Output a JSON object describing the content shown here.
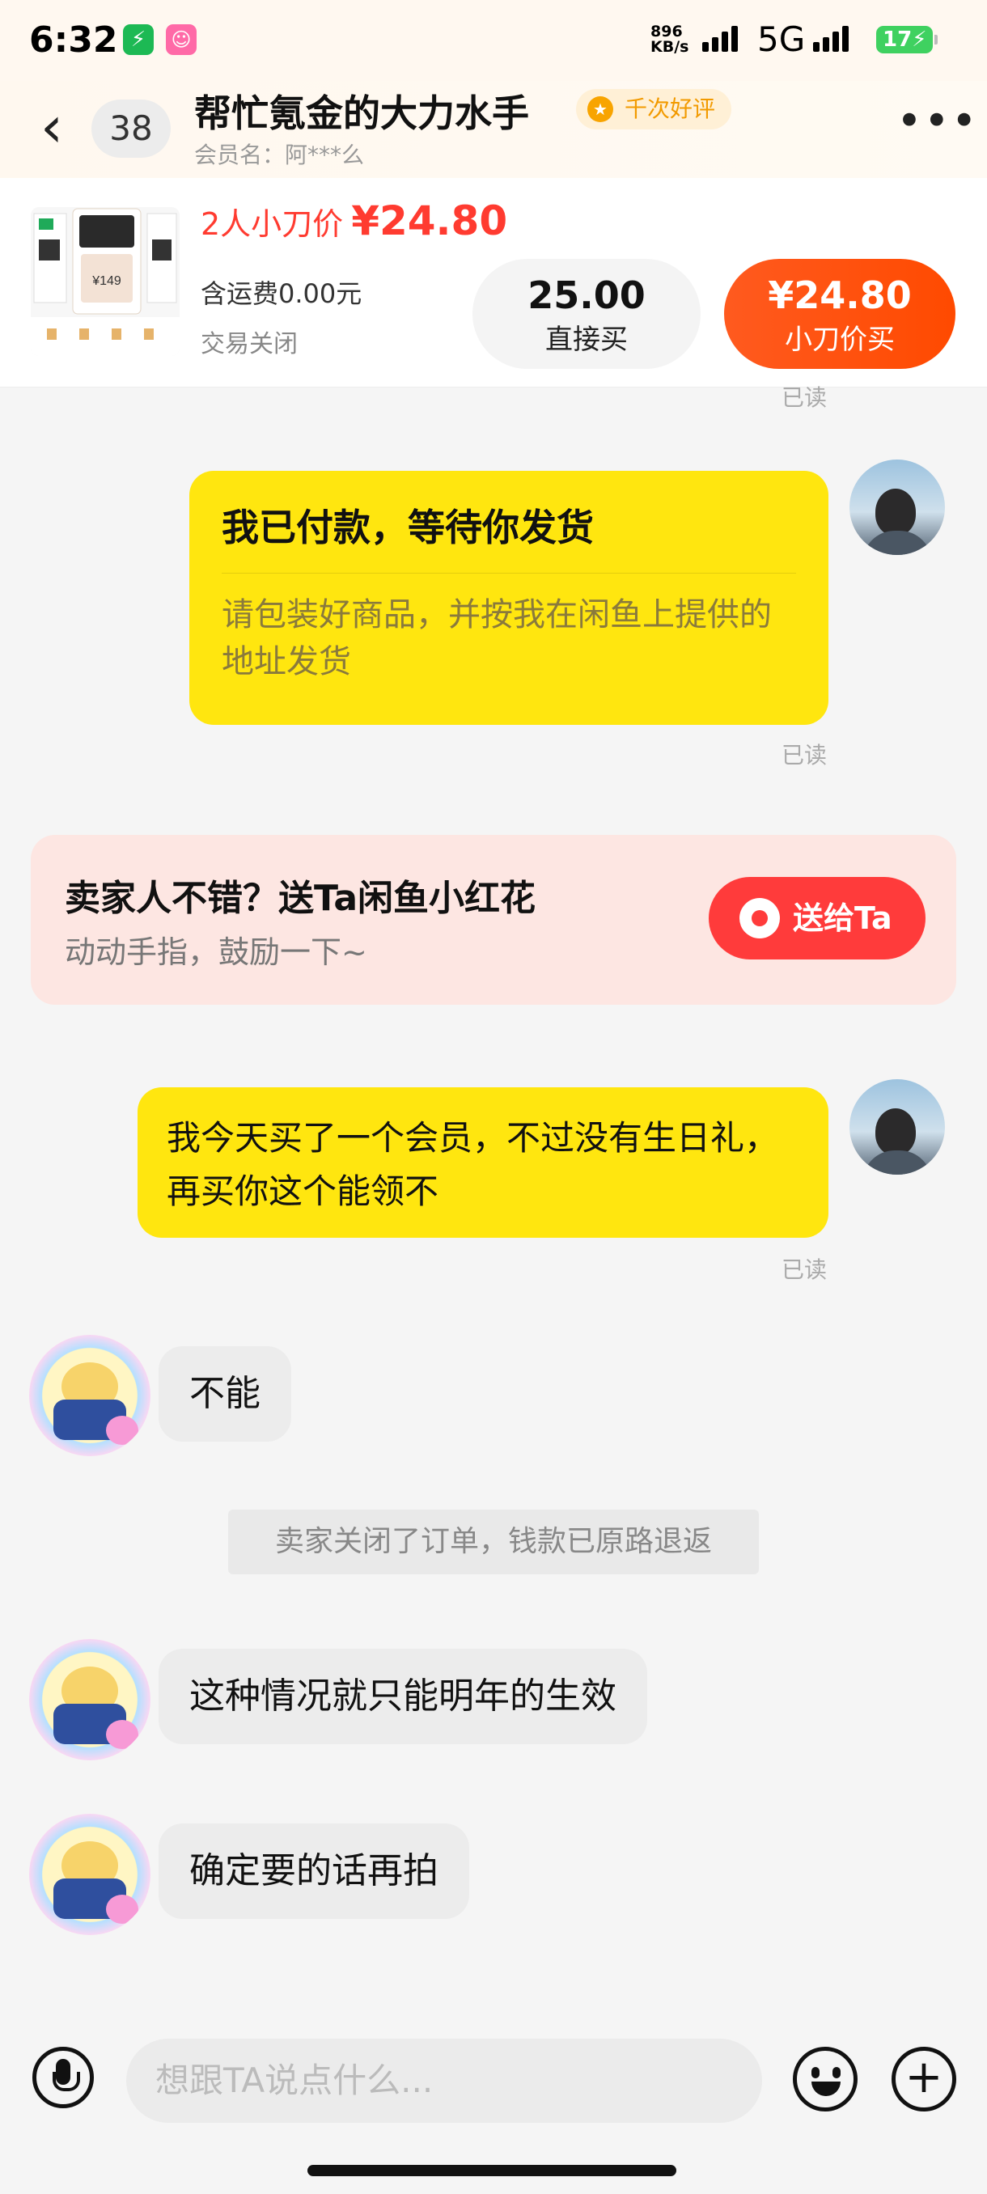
{
  "status_bar": {
    "time": "6:32",
    "net_speed": "896 KB/s",
    "network": "5G",
    "battery": "17"
  },
  "header": {
    "back_icon": "chevron-left-icon",
    "unread_count": "38",
    "title": "帮忙氪金的大力水手",
    "badge": "千次好评",
    "member_name": "会员名：阿***么"
  },
  "product": {
    "group_price_label": "2人小刀价",
    "group_price": "¥24.80",
    "shipping": "含运费0.00元",
    "status": "交易关闭",
    "direct_price": "25.00",
    "direct_label": "直接买",
    "knife_price": "¥24.80",
    "knife_label": "小刀价买"
  },
  "chat": {
    "read_top": "已读",
    "paid_card": {
      "title": "我已付款，等待你发货",
      "subtitle": "请包装好商品，并按我在闲鱼上提供的地址发货",
      "read": "已读"
    },
    "flower_card": {
      "title": "卖家人不错？送Ta闲鱼小红花",
      "subtitle": "动动手指，鼓励一下~",
      "button": "送给Ta"
    },
    "messages": [
      {
        "from": "me",
        "text": "我今天买了一个会员，不过没有生日礼，再买你这个能领不",
        "read": "已读"
      },
      {
        "from": "seller",
        "text": "不能"
      },
      {
        "from": "system",
        "text": "卖家关闭了订单，钱款已原路退返"
      },
      {
        "from": "seller",
        "text": "这种情况就只能明年的生效"
      },
      {
        "from": "seller",
        "text": "确定要的话再拍"
      }
    ]
  },
  "input_bar": {
    "placeholder": "想跟TA说点什么...",
    "mic_icon": "microphone-icon",
    "emoji_icon": "emoji-icon",
    "plus_icon": "plus-icon"
  },
  "colors": {
    "accent_yellow": "#ffe60f",
    "price_red": "#ff3b30",
    "knife_button": "#ff4a00",
    "flower_button": "#ff3b3b"
  }
}
